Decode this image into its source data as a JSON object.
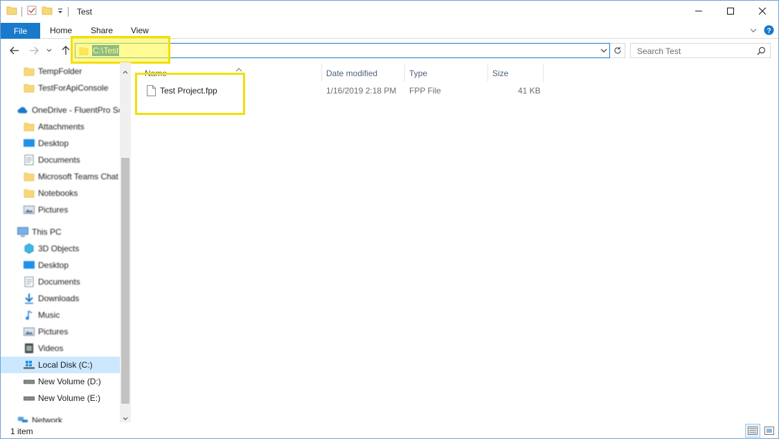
{
  "window": {
    "title": "Test",
    "colors": {
      "accent": "#1979ca",
      "highlight_box": "#f2df00",
      "selection": "#cce8ff",
      "address_selection": "#0078d7"
    }
  },
  "ribbon": {
    "file_tab": "File",
    "tabs": [
      "Home",
      "Share",
      "View"
    ]
  },
  "address": {
    "path": "C:\\Test",
    "search_placeholder": "Search Test"
  },
  "nav_pane": {
    "items": [
      {
        "label": "TempFolder",
        "icon": "folder-icon"
      },
      {
        "label": "TestForApiConsole",
        "icon": "folder-icon"
      },
      {
        "label": "OneDrive - FluentPro Sc",
        "icon": "onedrive-cloud-icon"
      },
      {
        "label": "Attachments",
        "icon": "folder-icon"
      },
      {
        "label": "Desktop",
        "icon": "desktop-icon"
      },
      {
        "label": "Documents",
        "icon": "documents-icon"
      },
      {
        "label": "Microsoft Teams Chat",
        "icon": "folder-icon"
      },
      {
        "label": "Notebooks",
        "icon": "folder-icon"
      },
      {
        "label": "Pictures",
        "icon": "pictures-icon"
      },
      {
        "label": "This PC",
        "icon": "this-pc-icon"
      },
      {
        "label": "3D Objects",
        "icon": "3d-objects-icon"
      },
      {
        "label": "Desktop",
        "icon": "desktop-icon"
      },
      {
        "label": "Documents",
        "icon": "documents-icon"
      },
      {
        "label": "Downloads",
        "icon": "downloads-icon"
      },
      {
        "label": "Music",
        "icon": "music-icon"
      },
      {
        "label": "Pictures",
        "icon": "pictures-icon"
      },
      {
        "label": "Videos",
        "icon": "videos-icon"
      },
      {
        "label": "Local Disk (C:)",
        "icon": "windows-drive-icon"
      },
      {
        "label": "New Volume (D:)",
        "icon": "drive-icon"
      },
      {
        "label": "New Volume (E:)",
        "icon": "drive-icon"
      },
      {
        "label": "Network",
        "icon": "network-icon"
      }
    ],
    "selected": "Local Disk (C:)"
  },
  "file_list": {
    "columns": [
      "Name",
      "Date modified",
      "Type",
      "Size"
    ],
    "rows": [
      {
        "name": "Test Project.fpp",
        "date_modified": "1/16/2019 2:18 PM",
        "type": "FPP File",
        "size": "41 KB"
      }
    ]
  },
  "status": {
    "item_count": "1 item"
  }
}
